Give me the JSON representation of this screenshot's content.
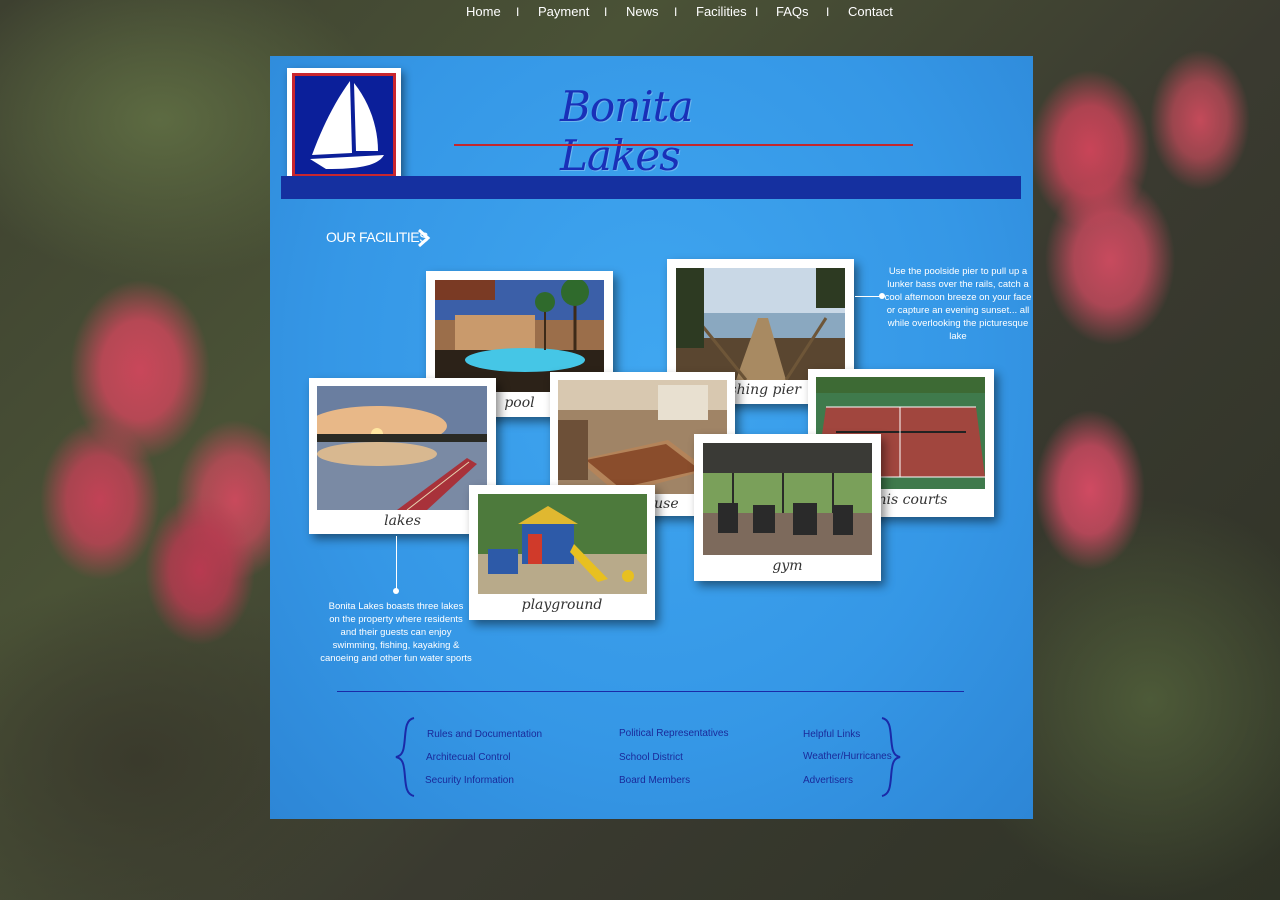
{
  "site": {
    "title": "Bonita Lakes"
  },
  "nav": {
    "items": [
      {
        "label": "Home"
      },
      {
        "label": "Payment"
      },
      {
        "label": "News"
      },
      {
        "label": "Facilities"
      },
      {
        "label": "FAQs"
      },
      {
        "label": "Contact"
      }
    ],
    "separator": "I"
  },
  "facilities": {
    "heading": "OUR FACILITIES",
    "photos": {
      "pool": {
        "caption": "pool"
      },
      "fishing_pier": {
        "caption": "fishing pier"
      },
      "lakes": {
        "caption": "lakes"
      },
      "clubhouse": {
        "caption": "clubhouse"
      },
      "tennis_courts": {
        "caption": "tennis courts"
      },
      "gym": {
        "caption": "gym"
      },
      "playground": {
        "caption": "playground"
      }
    },
    "pier_blurb": [
      "Use the poolside pier to pull up a",
      "lunker bass over the rails, catch a",
      "cool afternoon breeze on your face",
      "or capture an evening sunset... all",
      "while overlooking the picturesque lake"
    ],
    "lakes_blurb": [
      "Bonita Lakes boasts three lakes",
      "on the property where residents",
      "and their guests can enjoy",
      "swimming, fishing, kayaking &",
      "canoeing and other fun water sports"
    ]
  },
  "footer": {
    "col1": [
      "Rules and Documentation",
      "Architecual Control",
      "Security Information"
    ],
    "col2": [
      "Political Representatives",
      "School District",
      "Board Members"
    ],
    "col3": [
      "Helpful Links",
      "Weather/Hurricanes",
      "Advertisers"
    ]
  },
  "colors": {
    "panel": "#3597e6",
    "navbar": "#1530a0",
    "accent_red": "#c3272d",
    "title_blue": "#1930b8"
  }
}
